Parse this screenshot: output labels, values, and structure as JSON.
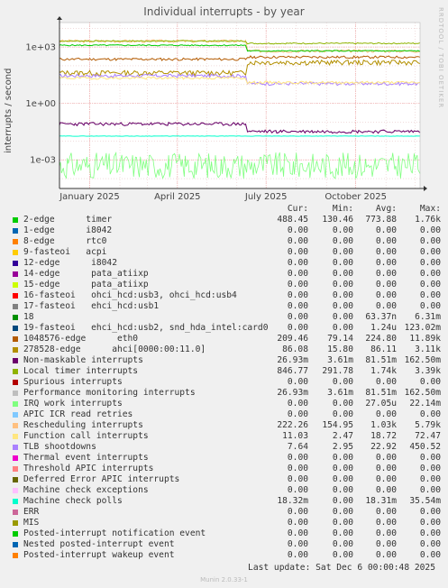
{
  "page": {
    "watermark": "RRDTOOL / TOBI OETIKER",
    "last_update_label": "Last update:",
    "last_update_value": "Sat Dec  6 00:00:48 2025",
    "footer": "Munin 2.0.33-1"
  },
  "chart_data": {
    "type": "line",
    "title": "Individual interrupts - by year",
    "ylabel": "interrupts / second",
    "yscale": "log",
    "ylim": [
      3e-05,
      20000
    ],
    "y_ticks": [
      "1e+03",
      "1e+00",
      "1e-03"
    ],
    "x_ticks": [
      "January 2025",
      "April 2025",
      "July 2025",
      "October 2025"
    ],
    "x_range": [
      "2024-12-01",
      "2025-12-06"
    ],
    "grid": true,
    "legend_headers": {
      "cur": "Cur:",
      "min": "Min:",
      "avg": "Avg:",
      "max": "Max:"
    },
    "series": [
      {
        "name": "2-edge      timer",
        "color": "#00cc00",
        "cur": "488.45",
        "min": "130.46",
        "avg": "773.88",
        "max": "1.76k"
      },
      {
        "name": "1-edge      i8042",
        "color": "#0066b3",
        "cur": "0.00",
        "min": "0.00",
        "avg": "0.00",
        "max": "0.00"
      },
      {
        "name": "8-edge      rtc0",
        "color": "#ff8000",
        "cur": "0.00",
        "min": "0.00",
        "avg": "0.00",
        "max": "0.00"
      },
      {
        "name": "9-fasteoi   acpi",
        "color": "#ffcc00",
        "cur": "0.00",
        "min": "0.00",
        "avg": "0.00",
        "max": "0.00"
      },
      {
        "name": "12-edge      i8042",
        "color": "#330099",
        "cur": "0.00",
        "min": "0.00",
        "avg": "0.00",
        "max": "0.00"
      },
      {
        "name": "14-edge      pata_atiixp",
        "color": "#990099",
        "cur": "0.00",
        "min": "0.00",
        "avg": "0.00",
        "max": "0.00"
      },
      {
        "name": "15-edge      pata_atiixp",
        "color": "#ccff00",
        "cur": "0.00",
        "min": "0.00",
        "avg": "0.00",
        "max": "0.00"
      },
      {
        "name": "16-fasteoi   ohci_hcd:usb3, ohci_hcd:usb4",
        "color": "#ff0000",
        "cur": "0.00",
        "min": "0.00",
        "avg": "0.00",
        "max": "0.00"
      },
      {
        "name": "17-fasteoi   ehci_hcd:usb1",
        "color": "#808080",
        "cur": "0.00",
        "min": "0.00",
        "avg": "0.00",
        "max": "0.00"
      },
      {
        "name": "18",
        "color": "#008f00",
        "cur": "0.00",
        "min": "0.00",
        "avg": "63.37n",
        "max": "6.31m"
      },
      {
        "name": "19-fasteoi   ehci_hcd:usb2, snd_hda_intel:card0",
        "color": "#00487d",
        "cur": "0.00",
        "min": "0.00",
        "avg": "1.24u",
        "max": "123.02m"
      },
      {
        "name": "1048576-edge      eth0",
        "color": "#b35a00",
        "cur": "209.46",
        "min": "79.14",
        "avg": "224.80",
        "max": "11.89k"
      },
      {
        "name": "278528-edge      ahci[0000:00:11.0]",
        "color": "#b38f00",
        "cur": "86.08",
        "min": "15.80",
        "avg": "86.11",
        "max": "3.11k"
      },
      {
        "name": "Non-maskable interrupts",
        "color": "#6b006b",
        "cur": "26.93m",
        "min": "3.61m",
        "avg": "81.51m",
        "max": "162.50m"
      },
      {
        "name": "Local timer interrupts",
        "color": "#8fb300",
        "cur": "846.77",
        "min": "291.78",
        "avg": "1.74k",
        "max": "3.39k"
      },
      {
        "name": "Spurious interrupts",
        "color": "#b30000",
        "cur": "0.00",
        "min": "0.00",
        "avg": "0.00",
        "max": "0.00"
      },
      {
        "name": "Performance monitoring interrupts",
        "color": "#bebebe",
        "cur": "26.93m",
        "min": "3.61m",
        "avg": "81.51m",
        "max": "162.50m"
      },
      {
        "name": "IRQ work interrupts",
        "color": "#80ff80",
        "cur": "0.00",
        "min": "0.00",
        "avg": "27.05u",
        "max": "22.14m"
      },
      {
        "name": "APIC ICR read retries",
        "color": "#80c9ff",
        "cur": "0.00",
        "min": "0.00",
        "avg": "0.00",
        "max": "0.00"
      },
      {
        "name": "Rescheduling interrupts",
        "color": "#ffc080",
        "cur": "222.26",
        "min": "154.95",
        "avg": "1.03k",
        "max": "5.79k"
      },
      {
        "name": "Function call interrupts",
        "color": "#ffe680",
        "cur": "11.03",
        "min": "2.47",
        "avg": "18.72",
        "max": "72.47"
      },
      {
        "name": "TLB shootdowns",
        "color": "#aa80ff",
        "cur": "7.64",
        "min": "2.95",
        "avg": "22.92",
        "max": "450.52"
      },
      {
        "name": "Thermal event interrupts",
        "color": "#ee00cc",
        "cur": "0.00",
        "min": "0.00",
        "avg": "0.00",
        "max": "0.00"
      },
      {
        "name": "Threshold APIC interrupts",
        "color": "#ff8080",
        "cur": "0.00",
        "min": "0.00",
        "avg": "0.00",
        "max": "0.00"
      },
      {
        "name": "Deferred Error APIC interrupts",
        "color": "#666600",
        "cur": "0.00",
        "min": "0.00",
        "avg": "0.00",
        "max": "0.00"
      },
      {
        "name": "Machine check exceptions",
        "color": "#ffbfff",
        "cur": "0.00",
        "min": "0.00",
        "avg": "0.00",
        "max": "0.00"
      },
      {
        "name": "Machine check polls",
        "color": "#00ffcc",
        "cur": "18.32m",
        "min": "0.00",
        "avg": "18.31m",
        "max": "35.54m"
      },
      {
        "name": "ERR",
        "color": "#cc6699",
        "cur": "0.00",
        "min": "0.00",
        "avg": "0.00",
        "max": "0.00"
      },
      {
        "name": "MIS",
        "color": "#999900",
        "cur": "0.00",
        "min": "0.00",
        "avg": "0.00",
        "max": "0.00"
      },
      {
        "name": "Posted-interrupt notification event",
        "color": "#00cc00",
        "cur": "0.00",
        "min": "0.00",
        "avg": "0.00",
        "max": "0.00"
      },
      {
        "name": "Nested posted-interrupt event",
        "color": "#0066b3",
        "cur": "0.00",
        "min": "0.00",
        "avg": "0.00",
        "max": "0.00"
      },
      {
        "name": "Posted-interrupt wakeup event",
        "color": "#ff8000",
        "cur": "0.00",
        "min": "0.00",
        "avg": "0.00",
        "max": "0.00"
      }
    ]
  }
}
